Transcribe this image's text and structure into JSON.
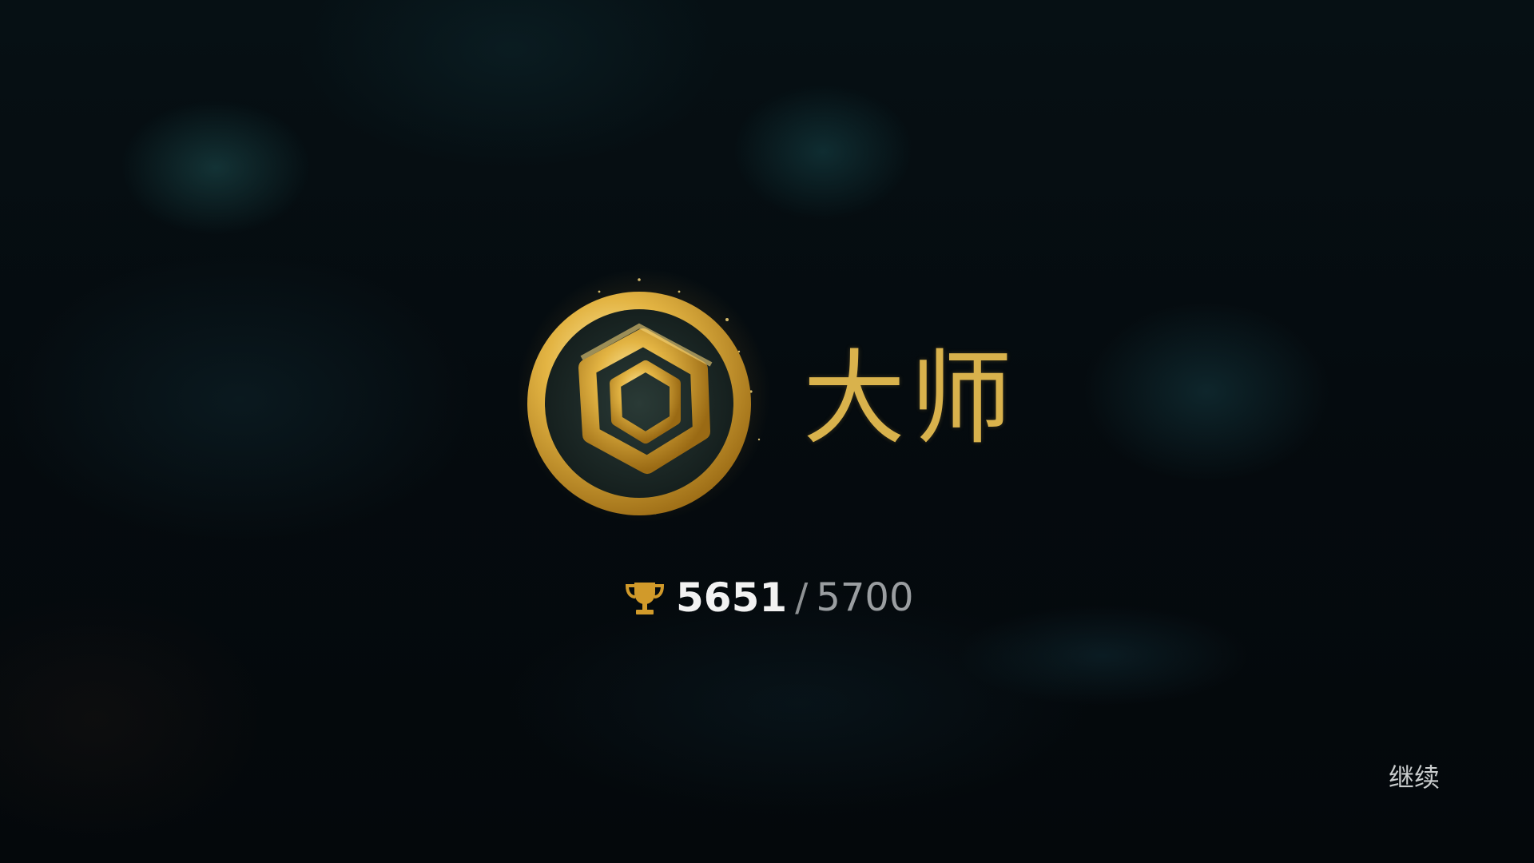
{
  "rank": {
    "name": "大师",
    "emblem_icon": "master-rank-emblem-icon",
    "color": "#d9b24c"
  },
  "score": {
    "icon": "trophy-icon",
    "current": "5651",
    "separator": "/",
    "target": "5700"
  },
  "actions": {
    "continue_label": "继续"
  }
}
